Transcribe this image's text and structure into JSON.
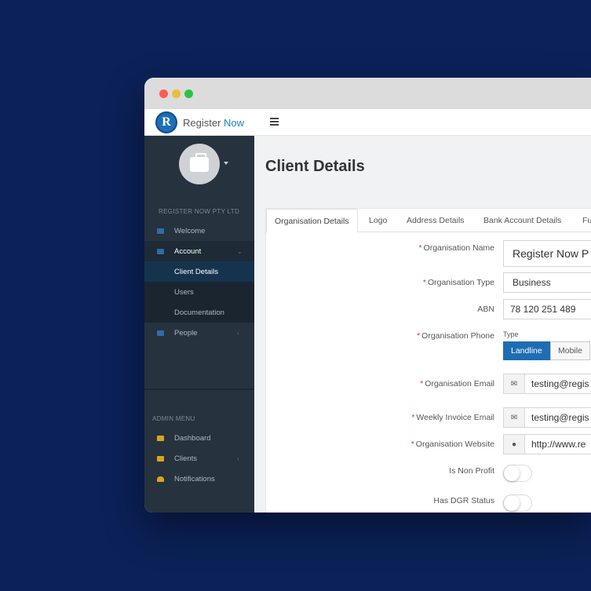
{
  "brand": {
    "name_primary": "Register",
    "name_accent": "Now",
    "logo_letter": "R"
  },
  "sidebar": {
    "company_label": "REGISTER NOW PTY LTD",
    "items": [
      {
        "label": "Welcome",
        "icon": "home-icon"
      },
      {
        "label": "Account",
        "icon": "briefcase-icon",
        "expanded": true
      },
      {
        "label": "Client Details"
      },
      {
        "label": "Users"
      },
      {
        "label": "Documentation"
      },
      {
        "label": "People",
        "icon": "users-icon"
      }
    ],
    "admin_label": "ADMIN MENU",
    "admin_items": [
      {
        "label": "Dashboard",
        "icon": "dashboard-icon"
      },
      {
        "label": "Clients",
        "icon": "users-icon"
      },
      {
        "label": "Notifications",
        "icon": "bell-icon"
      }
    ]
  },
  "page": {
    "title": "Client Details"
  },
  "tabs": [
    "Organisation Details",
    "Logo",
    "Address Details",
    "Bank Account Details",
    "Fu"
  ],
  "form": {
    "org_name": {
      "label": "Organisation Name",
      "value": "Register Now P"
    },
    "org_type": {
      "label": "Organisation Type",
      "value": "Business"
    },
    "abn": {
      "label": "ABN",
      "value": "78 120 251 489"
    },
    "org_phone": {
      "label": "Organisation Phone",
      "type_label": "Type",
      "options": [
        "Landline",
        "Mobile"
      ],
      "selected": "Landline"
    },
    "org_email": {
      "label": "Organisation Email",
      "value": "testing@regis"
    },
    "invoice_email": {
      "label": "Weekly Invoice Email",
      "value": "testing@regis"
    },
    "website": {
      "label": "Organisation Website",
      "value": "http://www.re"
    },
    "non_profit": {
      "label": "Is Non Profit",
      "on": false
    },
    "dgr": {
      "label": "Has DGR Status",
      "on": false
    }
  },
  "colors": {
    "background": "#0b2158",
    "sidebar": "#26323e",
    "accent": "#1e6db3",
    "required": "#d9363e"
  }
}
